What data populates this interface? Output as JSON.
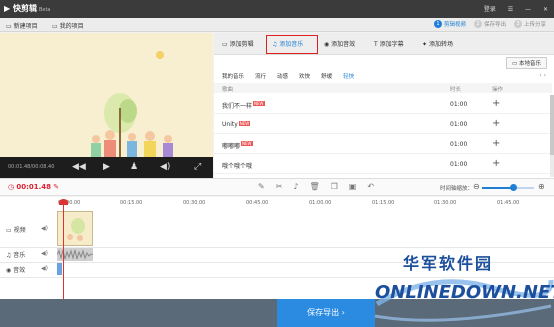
{
  "app": {
    "name": "快剪辑",
    "edition": "Beta"
  },
  "titlebar": {
    "login": "登录",
    "menu": "☰",
    "minimize": "—",
    "close": "✕"
  },
  "toolbar": {
    "new_project": "新建项目",
    "my_projects": "我的项目"
  },
  "steps": [
    {
      "num": "1",
      "label": "剪辑视频"
    },
    {
      "num": "2",
      "label": "保存导出"
    },
    {
      "num": "3",
      "label": "上传分享"
    }
  ],
  "player": {
    "time": "00:01.48/00:08.40"
  },
  "tabs": [
    {
      "label": "添加剪辑"
    },
    {
      "label": "添加音乐"
    },
    {
      "label": "添加音效"
    },
    {
      "label": "添加字幕"
    },
    {
      "label": "添加转场"
    }
  ],
  "music": {
    "local_button": "本地音乐",
    "categories": [
      "我的音乐",
      "流行",
      "动感",
      "欢快",
      "舒缓",
      "轻快"
    ],
    "header": {
      "name": "歌曲",
      "duration": "时长",
      "action": "操作"
    },
    "new_badge": "NEW",
    "rows": [
      {
        "name": "我们不一样",
        "duration": "01:00"
      },
      {
        "name": "Unity",
        "duration": "01:00"
      },
      {
        "name": "嘟嘟嘟",
        "duration": "01:00"
      },
      {
        "name": "哦个哦个哦",
        "duration": "01:00"
      }
    ]
  },
  "timeline": {
    "current_time": "00:01.48",
    "zoom_label": "时间轴缩放：",
    "ticks": [
      "00:00.00",
      "00:15.00",
      "00:30.00",
      "00:45.00",
      "01:00.00",
      "01:15.00",
      "01:30.00",
      "01:45.00"
    ],
    "tracks": {
      "video": "视频",
      "music": "音乐",
      "sfx": "音效"
    },
    "zoom_level": 0.6
  },
  "export_button": "保存导出",
  "watermark": {
    "cn": "华军软件园",
    "en": "ONLINEDOWN.NET"
  },
  "colors": {
    "accent": "#1f7fd6",
    "highlight": "#e02020",
    "playhead": "#d33333"
  }
}
